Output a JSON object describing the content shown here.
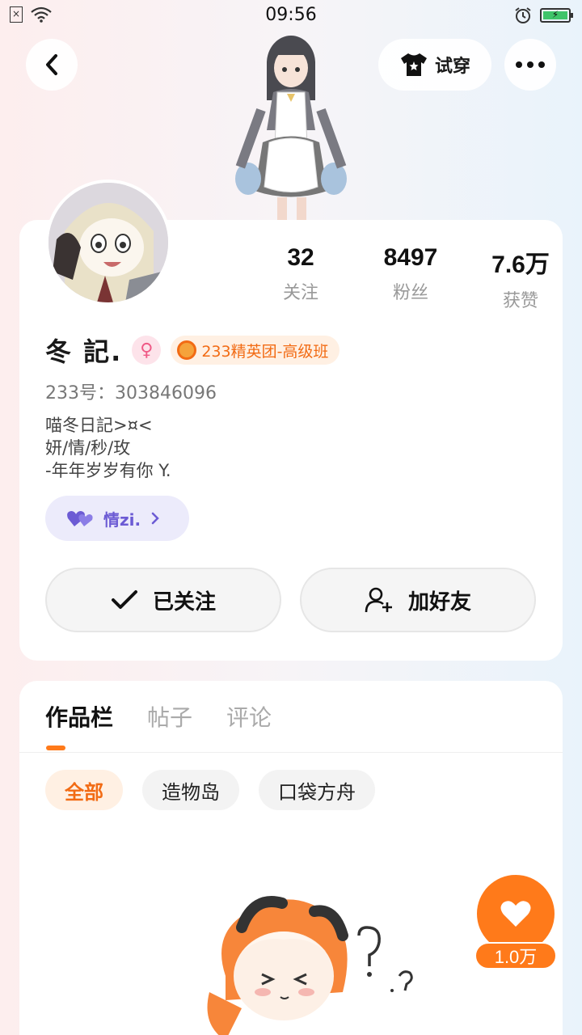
{
  "status_bar": {
    "time": "09:56",
    "sim_label": "×"
  },
  "header": {
    "tryon_label": "试穿"
  },
  "profile": {
    "stats": [
      {
        "value": "32",
        "label": "关注"
      },
      {
        "value": "8497",
        "label": "粉丝"
      },
      {
        "value": "7.6万",
        "label": "获赞"
      }
    ],
    "name": "冬 記.",
    "gender_symbol": "♀",
    "team_badge": "233精英团-高级班",
    "user_id": "233号：303846096",
    "bio_lines": [
      "喵冬日記>¤<",
      "妍/情/秒/玫",
      "-年年岁岁有你 Y."
    ],
    "relation_label": "情zi.",
    "follow_label": "已关注",
    "add_friend_label": "加好友"
  },
  "works": {
    "tabs": [
      {
        "label": "作品栏",
        "active": true
      },
      {
        "label": "帖子",
        "active": false
      },
      {
        "label": "评论",
        "active": false
      }
    ],
    "filters": [
      {
        "label": "全部",
        "active": true
      },
      {
        "label": "造物岛",
        "active": false
      },
      {
        "label": "口袋方舟",
        "active": false
      }
    ]
  },
  "like_fab": {
    "count": "1.0万"
  },
  "colors": {
    "accent": "#ff7a1a",
    "relation": "#6c5bd4",
    "gender": "#ef5a86"
  }
}
